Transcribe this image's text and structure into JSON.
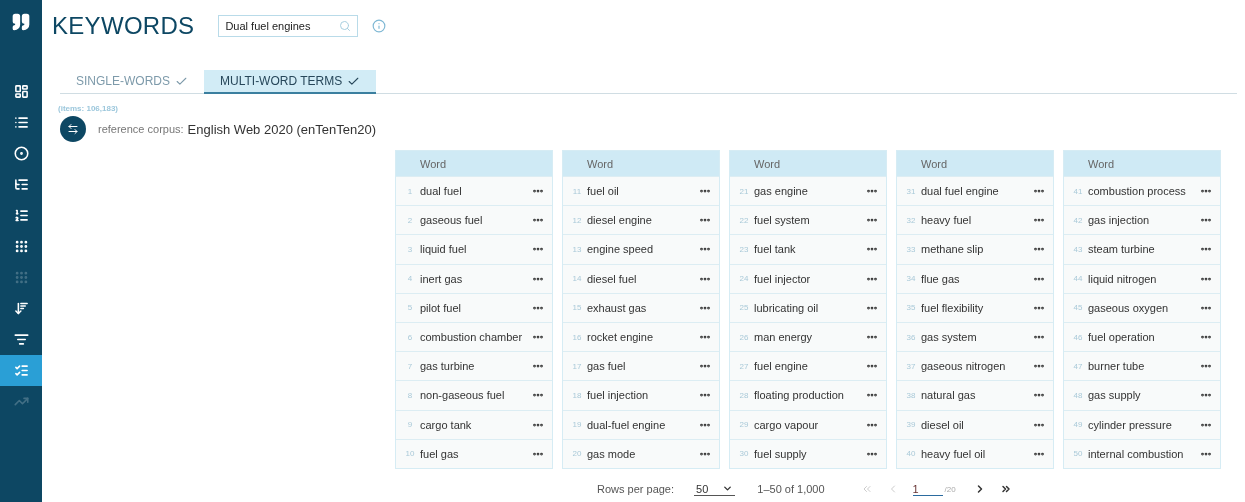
{
  "sidebar": {
    "items": [
      {
        "kind": "dashboard",
        "selected": false,
        "disabled": false
      },
      {
        "kind": "list",
        "selected": false,
        "disabled": false
      },
      {
        "kind": "target",
        "selected": false,
        "disabled": false
      },
      {
        "kind": "circles",
        "selected": false,
        "disabled": false
      },
      {
        "kind": "dotlist",
        "selected": false,
        "disabled": false
      },
      {
        "kind": "dotgrid",
        "selected": false,
        "disabled": false
      },
      {
        "kind": "dotgrid",
        "selected": false,
        "disabled": true
      },
      {
        "kind": "sortlist",
        "selected": false,
        "disabled": false
      },
      {
        "kind": "nlist",
        "selected": false,
        "disabled": false
      },
      {
        "kind": "keylist",
        "selected": true,
        "disabled": false
      },
      {
        "kind": "trend",
        "selected": false,
        "disabled": true
      }
    ]
  },
  "header": {
    "title": "KEYWORDS",
    "search": {
      "value": "Dual fuel engines"
    }
  },
  "tabs": [
    {
      "label": "SINGLE-WORDS",
      "selected": false,
      "checked": true
    },
    {
      "label": "MULTI-WORD TERMS",
      "selected": true,
      "checked": true
    }
  ],
  "items_count": "(items: 106,183)",
  "reference": {
    "label": "reference corpus:",
    "value": "English Web 2020 (enTenTen20)"
  },
  "tables": [
    {
      "header": "Word",
      "rows": [
        {
          "n": "1",
          "word": "dual fuel"
        },
        {
          "n": "2",
          "word": "gaseous fuel"
        },
        {
          "n": "3",
          "word": "liquid fuel"
        },
        {
          "n": "4",
          "word": "inert gas"
        },
        {
          "n": "5",
          "word": "pilot fuel"
        },
        {
          "n": "6",
          "word": "combustion chamber"
        },
        {
          "n": "7",
          "word": "gas turbine"
        },
        {
          "n": "8",
          "word": "non-gaseous fuel"
        },
        {
          "n": "9",
          "word": "cargo tank"
        },
        {
          "n": "10",
          "word": "fuel gas"
        }
      ]
    },
    {
      "header": "Word",
      "rows": [
        {
          "n": "11",
          "word": "fuel oil"
        },
        {
          "n": "12",
          "word": "diesel engine"
        },
        {
          "n": "13",
          "word": "engine speed"
        },
        {
          "n": "14",
          "word": "diesel fuel"
        },
        {
          "n": "15",
          "word": "exhaust gas"
        },
        {
          "n": "16",
          "word": "rocket engine"
        },
        {
          "n": "17",
          "word": "gas fuel"
        },
        {
          "n": "18",
          "word": "fuel injection"
        },
        {
          "n": "19",
          "word": "dual-fuel engine"
        },
        {
          "n": "20",
          "word": "gas mode"
        }
      ]
    },
    {
      "header": "Word",
      "rows": [
        {
          "n": "21",
          "word": "gas engine"
        },
        {
          "n": "22",
          "word": "fuel system"
        },
        {
          "n": "23",
          "word": "fuel tank"
        },
        {
          "n": "24",
          "word": "fuel injector"
        },
        {
          "n": "25",
          "word": "lubricating oil"
        },
        {
          "n": "26",
          "word": "man energy"
        },
        {
          "n": "27",
          "word": "fuel engine"
        },
        {
          "n": "28",
          "word": "floating production"
        },
        {
          "n": "29",
          "word": "cargo vapour"
        },
        {
          "n": "30",
          "word": "fuel supply"
        }
      ]
    },
    {
      "header": "Word",
      "rows": [
        {
          "n": "31",
          "word": "dual fuel engine"
        },
        {
          "n": "32",
          "word": "heavy fuel"
        },
        {
          "n": "33",
          "word": "methane slip"
        },
        {
          "n": "34",
          "word": "flue gas"
        },
        {
          "n": "35",
          "word": "fuel flexibility"
        },
        {
          "n": "36",
          "word": "gas system"
        },
        {
          "n": "37",
          "word": "gaseous nitrogen"
        },
        {
          "n": "38",
          "word": "natural gas"
        },
        {
          "n": "39",
          "word": "diesel oil"
        },
        {
          "n": "40",
          "word": "heavy fuel oil"
        }
      ]
    },
    {
      "header": "Word",
      "rows": [
        {
          "n": "41",
          "word": "combustion process"
        },
        {
          "n": "42",
          "word": "gas injection"
        },
        {
          "n": "43",
          "word": "steam turbine"
        },
        {
          "n": "44",
          "word": "liquid nitrogen"
        },
        {
          "n": "45",
          "word": "gaseous oxygen"
        },
        {
          "n": "46",
          "word": "fuel operation"
        },
        {
          "n": "47",
          "word": "burner tube"
        },
        {
          "n": "48",
          "word": "gas supply"
        },
        {
          "n": "49",
          "word": "cylinder pressure"
        },
        {
          "n": "50",
          "word": "internal combustion"
        }
      ]
    }
  ],
  "pagination": {
    "rows_label": "Rows per page:",
    "rows_value": "50",
    "range": "1–50 of 1,000",
    "first_disabled": true,
    "prev_disabled": true,
    "page": "1",
    "total": "/20"
  }
}
